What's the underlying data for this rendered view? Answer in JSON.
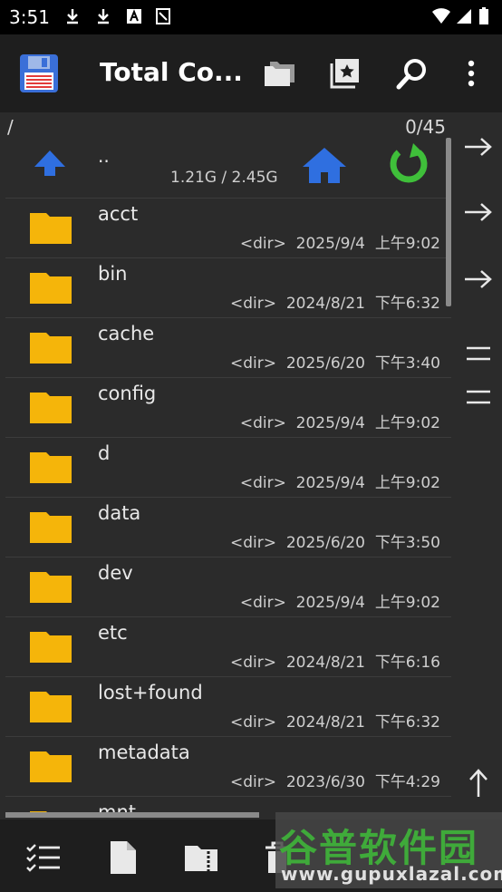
{
  "status_bar": {
    "time": "3:51"
  },
  "toolbar": {
    "title": "Total Co..."
  },
  "path_bar": {
    "path": "/",
    "count": "0/45"
  },
  "up_row": {
    "name": "..",
    "space": "1.21G / 2.45G"
  },
  "files": [
    {
      "name": "acct",
      "type": "<dir>",
      "date": "2025/9/4",
      "time": "上午9:02"
    },
    {
      "name": "bin",
      "type": "<dir>",
      "date": "2024/8/21",
      "time": "下午6:32"
    },
    {
      "name": "cache",
      "type": "<dir>",
      "date": "2025/6/20",
      "time": "下午3:40"
    },
    {
      "name": "config",
      "type": "<dir>",
      "date": "2025/9/4",
      "time": "上午9:02"
    },
    {
      "name": "d",
      "type": "<dir>",
      "date": "2025/9/4",
      "time": "上午9:02"
    },
    {
      "name": "data",
      "type": "<dir>",
      "date": "2025/6/20",
      "time": "下午3:50"
    },
    {
      "name": "dev",
      "type": "<dir>",
      "date": "2025/9/4",
      "time": "上午9:02"
    },
    {
      "name": "etc",
      "type": "<dir>",
      "date": "2024/8/21",
      "time": "下午6:16"
    },
    {
      "name": "lost+found",
      "type": "<dir>",
      "date": "2024/8/21",
      "time": "下午6:32"
    },
    {
      "name": "metadata",
      "type": "<dir>",
      "date": "2023/6/30",
      "time": "下午4:29"
    },
    {
      "name": "mnt",
      "type": "",
      "date": "",
      "time": ""
    }
  ],
  "watermark": {
    "line1": "谷普软件园",
    "line2": "www.gupuxlazal.com"
  },
  "colors": {
    "folder": "#f5b50a",
    "accent_blue": "#2f6fe0",
    "refresh_green": "#3fbf3a"
  }
}
